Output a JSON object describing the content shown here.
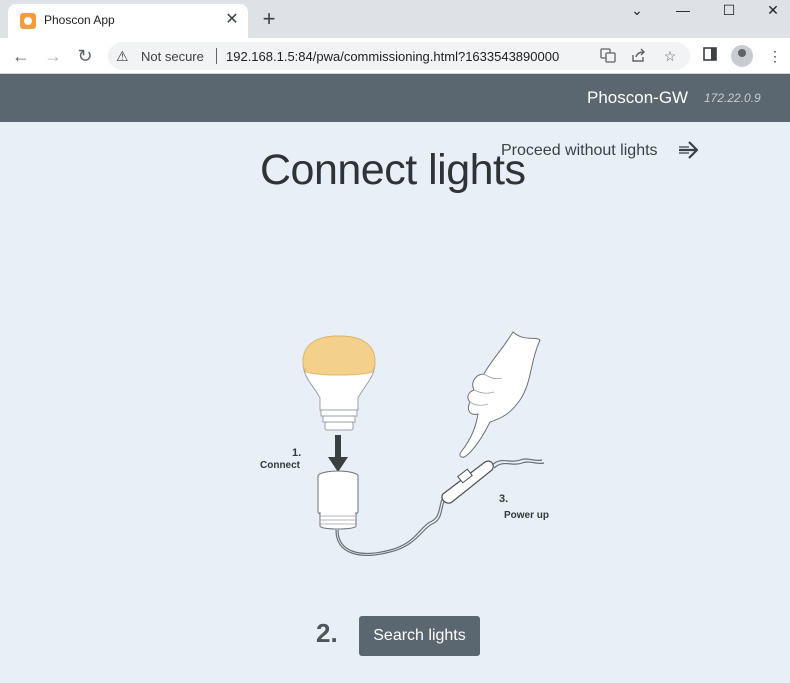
{
  "browser": {
    "tab_title": "Phoscon App",
    "tab_close": "✕",
    "new_tab": "+",
    "window_controls": {
      "minimize": "—",
      "maximize": "☐",
      "close": "✕",
      "tab_search": "⌄"
    },
    "nav": {
      "back": "←",
      "forward": "→",
      "reload": "↻"
    },
    "security_label": "Not secure",
    "url": "192.168.1.5:84/pwa/commissioning.html?1633543890000",
    "icons": [
      "translate-icon",
      "share-icon",
      "star-icon",
      "sidepanel-icon",
      "profile-icon",
      "menu-icon"
    ]
  },
  "appbar": {
    "gateway_name": "Phoscon-GW",
    "gateway_ip": "172.22.0.9"
  },
  "main": {
    "title": "Connect lights",
    "proceed_label": "Proceed without lights",
    "illustration": {
      "step1_number": "1.",
      "step1_label": "Connect",
      "step3_number": "3.",
      "step3_label": "Power up"
    },
    "step2_number": "2.",
    "search_button_label": "Search lights"
  },
  "colors": {
    "appbar": "#5a6670",
    "page_background": "#e8eff6",
    "button": "#5a6670",
    "bulb_glow": "#f4d18b"
  }
}
